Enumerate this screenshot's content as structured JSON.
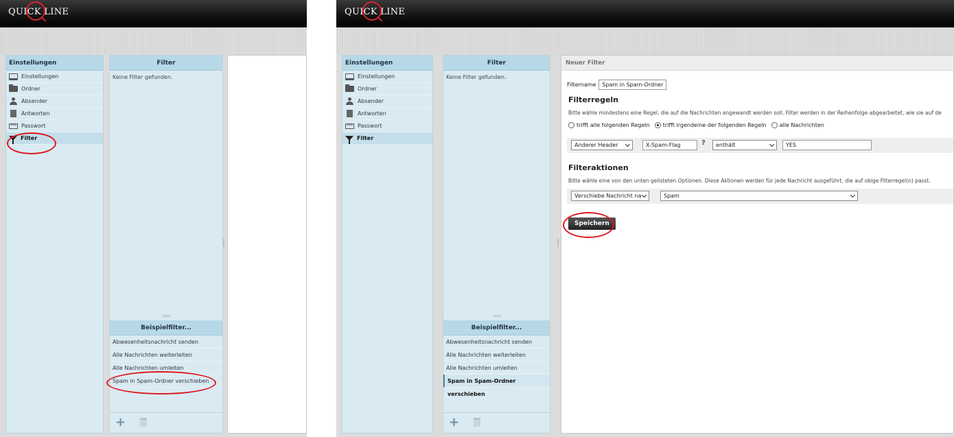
{
  "brand": {
    "logo_text": "QUICK LINE"
  },
  "settings_panel": {
    "header": "Einstellungen",
    "items": [
      {
        "label": "Einstellungen",
        "icon": "laptop-icon"
      },
      {
        "label": "Ordner",
        "icon": "folder-icon"
      },
      {
        "label": "Absender",
        "icon": "person-icon"
      },
      {
        "label": "Antworten",
        "icon": "document-icon"
      },
      {
        "label": "Passwort",
        "icon": "password-icon"
      },
      {
        "label": "Filter",
        "icon": "filter-icon",
        "active": true
      }
    ]
  },
  "filter_panel": {
    "header": "Filter",
    "empty_text": "Keine Filter gefunden."
  },
  "example_filters": {
    "header": "Beispielfilter...",
    "items": [
      "Abwesenheitsnachricht senden",
      "Alle Nachrichten weiterleiten",
      "Alle Nachrichten umleiten",
      "Spam in Spam-Ordner verschieben"
    ]
  },
  "new_filter": {
    "title": "Neuer Filter",
    "name_label": "Filtername",
    "name_value": "Spam in Spam-Ordner",
    "rules_heading": "Filterregeln",
    "rules_desc": "Bitte wähle mindestens eine Regel, die auf die Nachrichten angewandt werden soll. Filter werden in der Reihenfolge abgearbeitet, wie sie auf de",
    "radio_all": "trifft alle folgenden Regeln",
    "radio_any": "trifft irgendeine der folgenden Regeln",
    "radio_every": "alle Nachrichten",
    "rule": {
      "header_type": "Anderer Header",
      "header_name": "X-Spam-Flag",
      "help": "?",
      "operator": "enthält",
      "value": "YES"
    },
    "actions_heading": "Filteraktionen",
    "actions_desc": "Bitte wähle eine von den unten gelisteten Optionen. Diese Aktionen werden für jede Nachricht ausgeführt, die auf obige Filterregel(n) passt.",
    "action_type": "Verschiebe Nachricht na",
    "action_target": "Spam",
    "save_label": "Speichern"
  },
  "colors": {
    "highlight": "#e0161d",
    "panel": "#daeaf2",
    "panel_header": "#b7d8e6"
  }
}
